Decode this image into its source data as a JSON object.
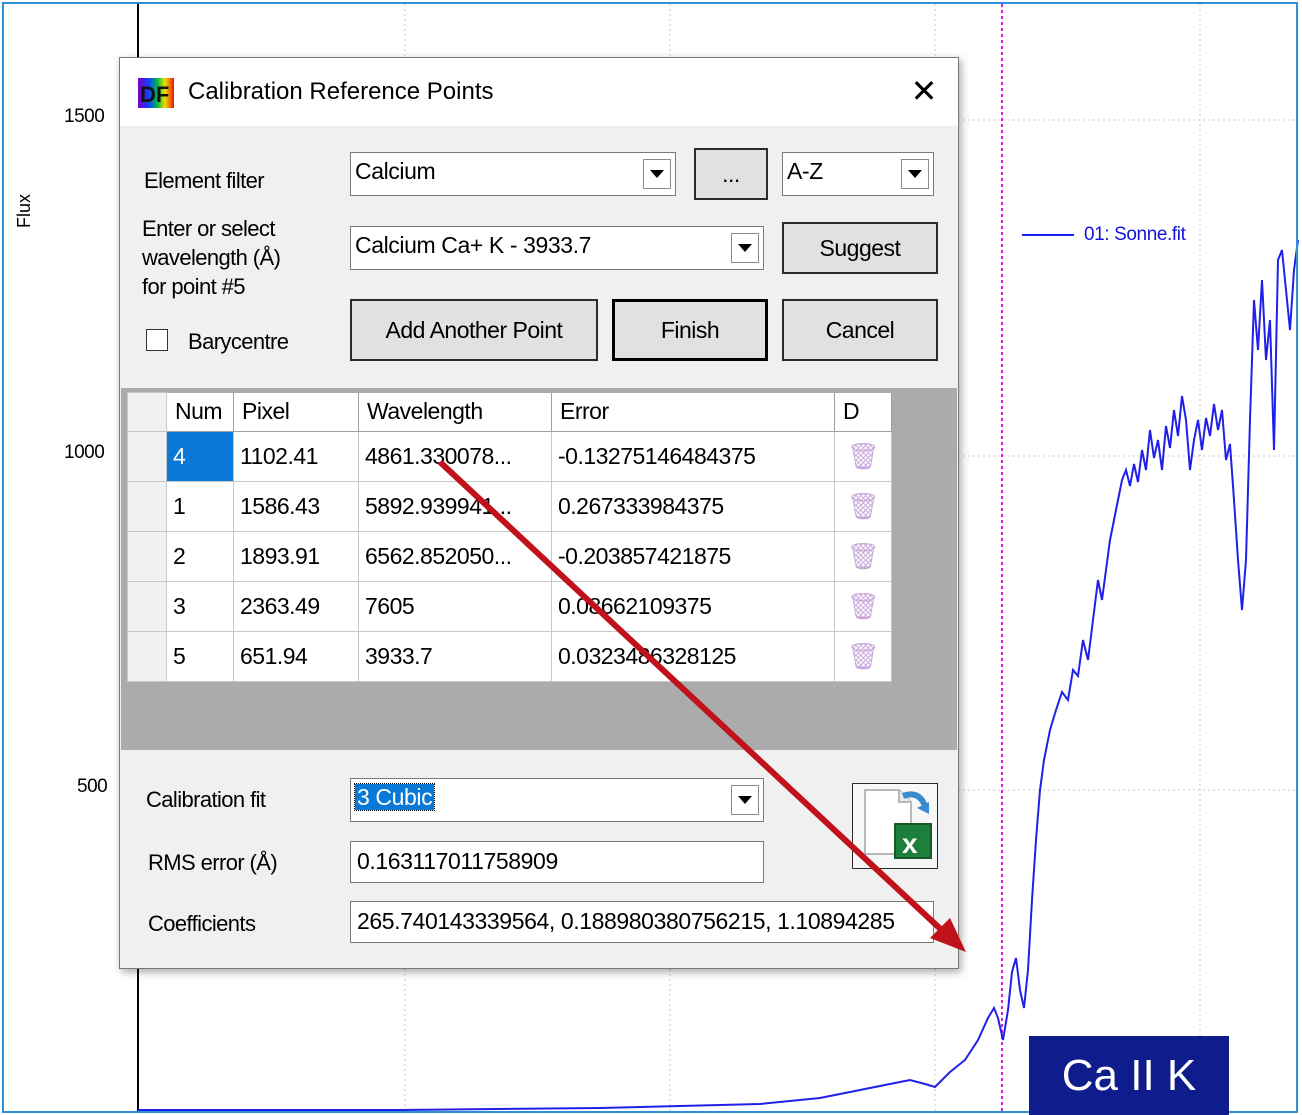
{
  "chart": {
    "y_ticks": [
      "1500",
      "1000",
      "500"
    ],
    "y_axis_label": "Flux",
    "legend_label": "01: Sonne.fit",
    "annotation": "Ca II K",
    "series_color": "#2020e8",
    "marker_color": "#e018d0"
  },
  "dialog": {
    "title": "Calibration Reference Points",
    "close_glyph": "✕",
    "element_filter_label": "Element filter",
    "element_filter_value": "Calcium",
    "browse_label": "...",
    "sort_value": "A-Z",
    "wavelength_label_lines": [
      "Enter or select",
      "wavelength (Å)",
      "for point #5"
    ],
    "wavelength_value": "Calcium Ca+ K - 3933.7",
    "suggest_label": "Suggest",
    "barycentre_label": "Barycentre",
    "add_point_label": "Add Another Point",
    "finish_label": "Finish",
    "cancel_label": "Cancel",
    "grid": {
      "columns": [
        "Num",
        "Pixel",
        "Wavelength",
        "Error",
        "D"
      ],
      "rows": [
        {
          "num": "4",
          "pixel": "1102.41",
          "wavelength": "4861.330078...",
          "error": "-0.13275146484375"
        },
        {
          "num": "1",
          "pixel": "1586.43",
          "wavelength": "5892.939941...",
          "error": "0.267333984375"
        },
        {
          "num": "2",
          "pixel": "1893.91",
          "wavelength": "6562.852050...",
          "error": "-0.203857421875"
        },
        {
          "num": "3",
          "pixel": "2363.49",
          "wavelength": "7605",
          "error": "0.08662109375"
        },
        {
          "num": "5",
          "pixel": "651.94",
          "wavelength": "3933.7",
          "error": "0.0323486328125"
        }
      ]
    },
    "fit_label": "Calibration fit",
    "fit_value": "3 Cubic",
    "rms_label": "RMS error (Å)",
    "rms_value": "0.163117011758909",
    "coeff_label": "Coefficients",
    "coeff_value": "265.740143339564, 0.188980380756215, 1.10894285"
  }
}
